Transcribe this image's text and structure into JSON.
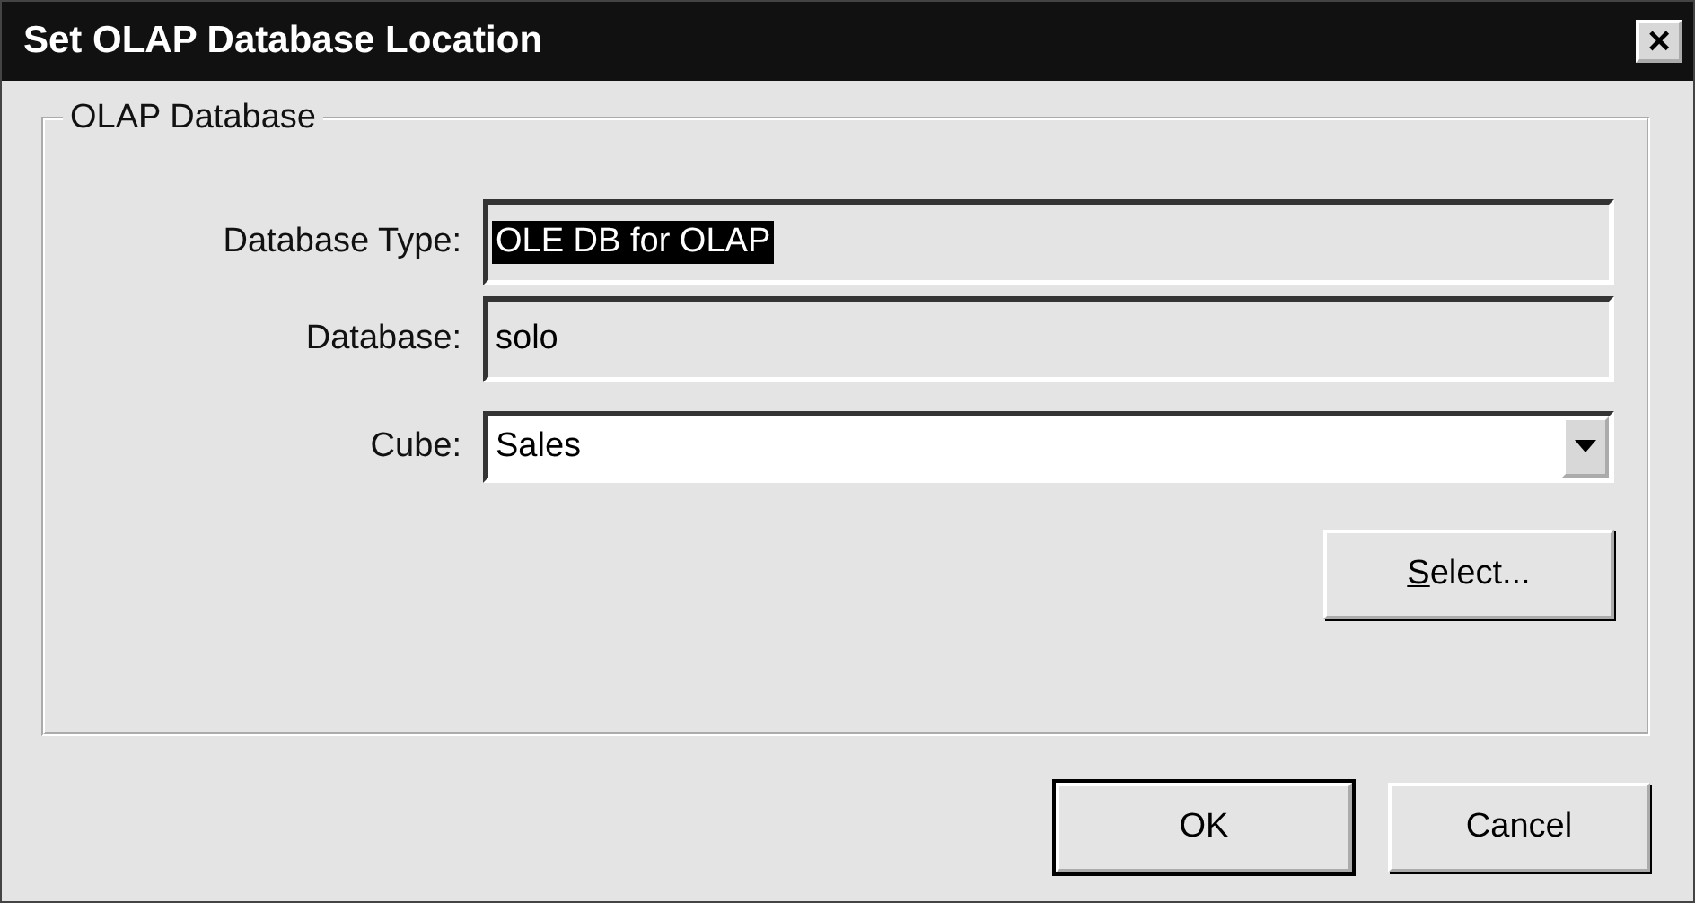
{
  "window": {
    "title": "Set OLAP Database Location",
    "close": "×"
  },
  "group": {
    "title": "OLAP Database",
    "fields": [
      {
        "kind": "text",
        "label": "Database Type:",
        "value": "OLE DB for OLAP",
        "selected": true,
        "disabled": true
      },
      {
        "kind": "text",
        "label": "Database:",
        "value": "solo",
        "selected": false,
        "disabled": true
      },
      {
        "kind": "combo",
        "label": "Cube:",
        "value": "Sales",
        "selected": false,
        "disabled": false
      }
    ],
    "select_button": {
      "mnemonic": "S",
      "rest": "elect..."
    }
  },
  "buttons": [
    {
      "label": "OK",
      "default": true
    },
    {
      "label": "Cancel",
      "default": false
    }
  ]
}
